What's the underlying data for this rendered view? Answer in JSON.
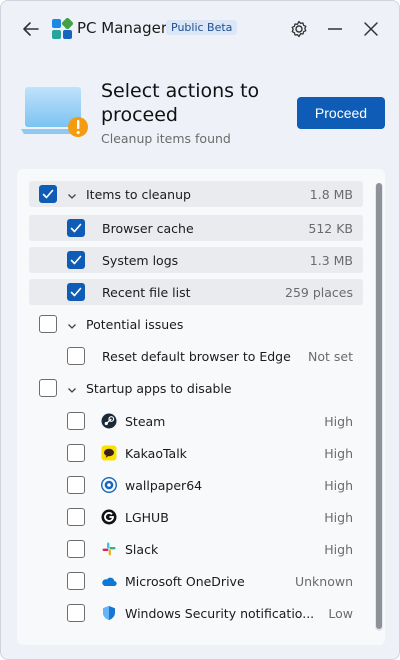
{
  "app": {
    "title": "PC Manager",
    "badge": "Public Beta"
  },
  "header": {
    "title": "Select actions to proceed",
    "subtitle": "Cleanup items found",
    "proceed_label": "Proceed"
  },
  "sections": {
    "cleanup": {
      "label": "Items to cleanup",
      "value": "1.8 MB",
      "checked": true,
      "items": [
        {
          "label": "Browser cache",
          "value": "512 KB"
        },
        {
          "label": "System logs",
          "value": "1.3 MB"
        },
        {
          "label": "Recent file list",
          "value": "259 places"
        }
      ]
    },
    "issues": {
      "label": "Potential issues",
      "items": [
        {
          "label": "Reset default browser to Edge",
          "value": "Not set"
        }
      ]
    },
    "startup": {
      "label": "Startup apps to disable",
      "items": [
        {
          "label": "Steam",
          "value": "High",
          "icon": "steam-icon"
        },
        {
          "label": "KakaoTalk",
          "value": "High",
          "icon": "kakaotalk-icon"
        },
        {
          "label": "wallpaper64",
          "value": "High",
          "icon": "wallpaper-engine-icon"
        },
        {
          "label": "LGHUB",
          "value": "High",
          "icon": "lghub-icon"
        },
        {
          "label": "Slack",
          "value": "High",
          "icon": "slack-icon"
        },
        {
          "label": "Microsoft OneDrive",
          "value": "Unknown",
          "icon": "onedrive-icon"
        },
        {
          "label": "Windows Security notificatio...",
          "value": "Low",
          "icon": "windows-security-icon"
        }
      ]
    }
  },
  "colors": {
    "accent": "#0f5cb6",
    "window_bg": "#eef2f8",
    "card_bg": "#f8f9fb",
    "warning": "#f39c12"
  }
}
